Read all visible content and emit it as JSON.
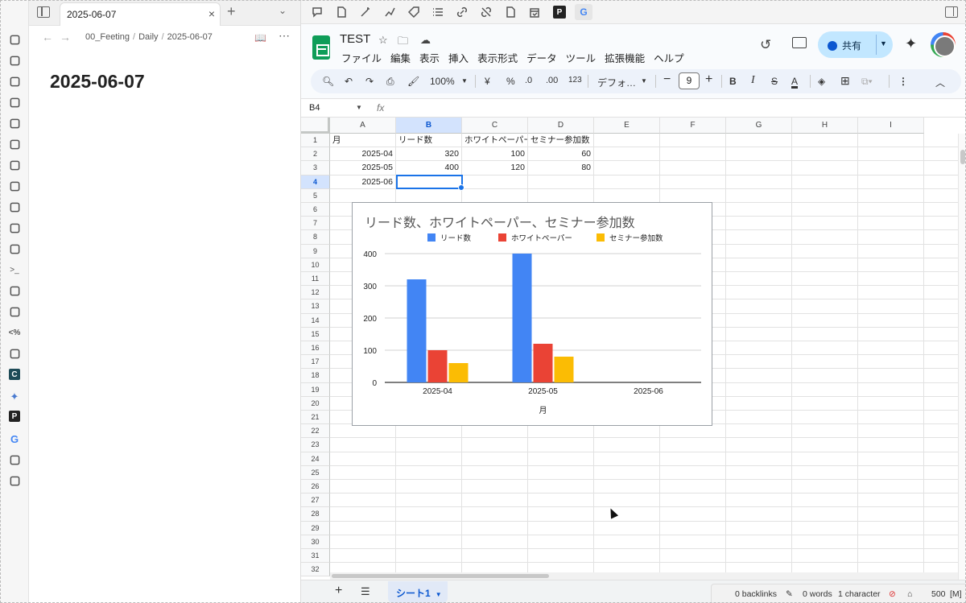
{
  "obsidian": {
    "tab_title": "2025-06-07",
    "breadcrumb": [
      "00_Feeting",
      "Daily",
      "2025-06-07"
    ],
    "note_title": "2025-06-07",
    "ribbon_icons": [
      "inbox-icon",
      "file-import-icon",
      "calendar-icon",
      "dashboard-icon",
      "magic-wand-icon",
      "lightbulb-icon",
      "signature-icon",
      "graph-icon",
      "chat-icon",
      "scissors-icon",
      "tablet-icon",
      "terminal-icon",
      "copy-icon",
      "git-icon",
      "template-icon",
      "kanban-icon",
      "c-app-icon",
      "sparkle-icon",
      "p-app-icon",
      "google-icon",
      "graph-analysis-icon",
      "comment-icon"
    ]
  },
  "sheets": {
    "doc_title": "TEST",
    "menu": [
      "ファイル",
      "編集",
      "表示",
      "挿入",
      "表示形式",
      "データ",
      "ツール",
      "拡張機能",
      "ヘルプ"
    ],
    "share_label": "共有",
    "toolbar": {
      "zoom": "100%",
      "currency": "¥",
      "percent": "%",
      "dec_decrease": ".0",
      "dec_increase": ".00",
      "format_123": "123",
      "font": "デフォ…",
      "font_size": "9"
    },
    "name_box": "B4",
    "fx": "fx",
    "columns": [
      "A",
      "B",
      "C",
      "D",
      "E",
      "F",
      "G",
      "H",
      "I"
    ],
    "rows": [
      "1",
      "2",
      "3",
      "4",
      "5",
      "6",
      "7",
      "8",
      "9",
      "10",
      "11",
      "12",
      "13",
      "14",
      "15",
      "16",
      "17",
      "18",
      "19",
      "20",
      "21",
      "22",
      "23",
      "24",
      "25",
      "26",
      "27",
      "28",
      "29",
      "30",
      "31",
      "32"
    ],
    "cells": {
      "A1": "月",
      "B1": "リード数",
      "C1": "ホワイトペーパー",
      "D1": "セミナー参加数",
      "A2": "2025-04",
      "B2": "320",
      "C2": "100",
      "D2": "60",
      "A3": "2025-05",
      "B3": "400",
      "C3": "120",
      "D3": "80",
      "A4": "2025-06"
    },
    "sheet_tab": "シート1"
  },
  "chart_data": {
    "type": "bar",
    "title": "リード数、ホワイトペーパー、セミナー参加数",
    "categories": [
      "2025-04",
      "2025-05",
      "2025-06"
    ],
    "series": [
      {
        "name": "リード数",
        "values": [
          320,
          400,
          null
        ],
        "color": "#4285f4"
      },
      {
        "name": "ホワイトペーパー",
        "values": [
          100,
          120,
          null
        ],
        "color": "#ea4335"
      },
      {
        "name": "セミナー参加数",
        "values": [
          60,
          80,
          null
        ],
        "color": "#fbbc04"
      }
    ],
    "xlabel": "月",
    "ylabel": "",
    "ylim": [
      0,
      400
    ],
    "yticks": [
      0,
      100,
      200,
      300,
      400
    ],
    "legend": "top",
    "grid": true
  },
  "status": {
    "backlinks": "0 backlinks",
    "words": "0 words",
    "chars": "1 character",
    "count": "500",
    "mode": "[M]"
  }
}
